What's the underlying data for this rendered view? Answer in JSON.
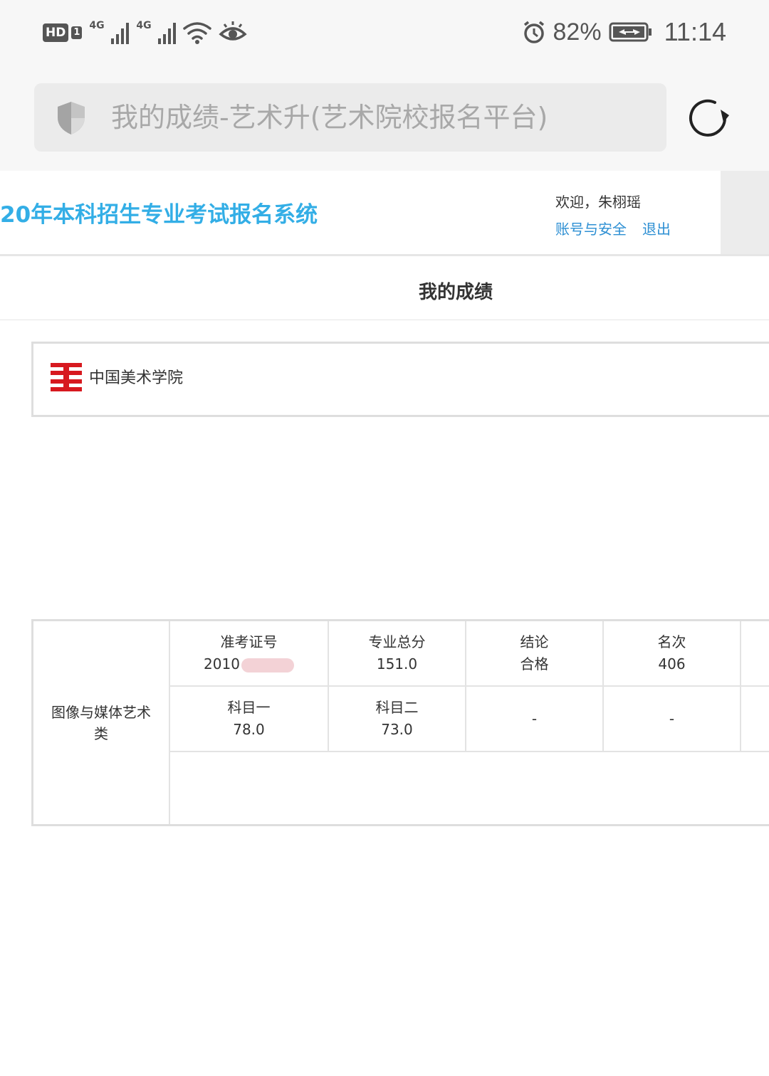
{
  "status_bar": {
    "hd_label": "HD",
    "sim_label": "1",
    "network_1": "4G",
    "network_2": "4G",
    "battery": "82%",
    "time": "11:14",
    "icons": [
      "wifi-icon",
      "eye-icon",
      "alarm-icon",
      "battery-charging-icon"
    ]
  },
  "browser": {
    "page_title": "我的成绩-艺术升(艺术院校报名平台)",
    "icons": [
      "shield-icon",
      "reload-icon"
    ]
  },
  "header": {
    "site_title": "20年本科招生专业考试报名系统",
    "welcome": "欢迎，朱栩瑶",
    "account_link": "账号与安全",
    "logout_link": "退出",
    "accent_color": "#33aee6",
    "link_color": "#2d8fd3"
  },
  "page": {
    "title": "我的成绩"
  },
  "school": {
    "name": "中国美术学院",
    "logo_color": "#d7191f"
  },
  "score": {
    "major": "图像与媒体艺术类",
    "row1": [
      {
        "label": "准考证号",
        "value": "2010"
      },
      {
        "label": "专业总分",
        "value": "151.0"
      },
      {
        "label": "结论",
        "value": "合格"
      },
      {
        "label": "名次",
        "value": "406"
      }
    ],
    "row2": [
      {
        "label": "科目一",
        "value": "78.0"
      },
      {
        "label": "科目二",
        "value": "73.0"
      },
      {
        "label": "",
        "value": "-"
      },
      {
        "label": "",
        "value": "-"
      }
    ]
  }
}
